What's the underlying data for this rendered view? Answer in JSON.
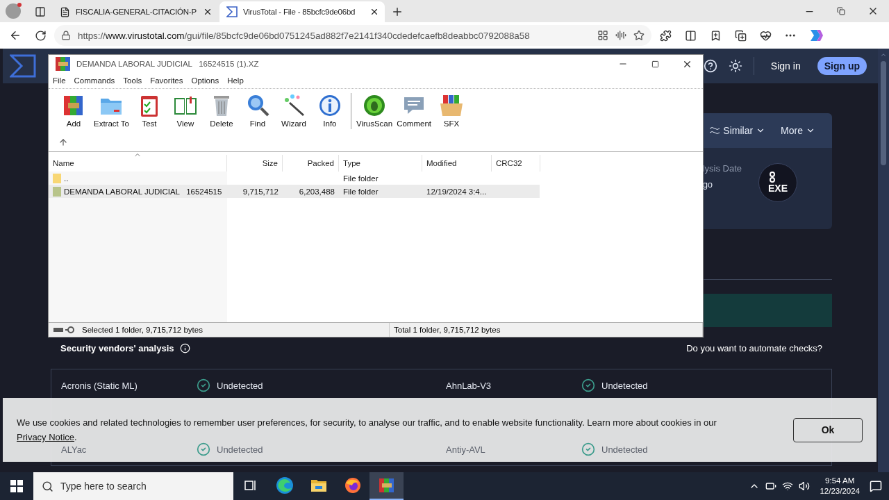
{
  "browser": {
    "tabs": [
      {
        "title": "FISCALIA-GENERAL-CITACIÓN-P",
        "kind": "document",
        "selected": false
      },
      {
        "title": "VirusTotal - File - 85bcfc9de06bd",
        "kind": "virustotal",
        "selected": true
      }
    ],
    "url": {
      "prefix": "https://",
      "domain": "www.virustotal.com",
      "path": "/gui/file/85bcfc9de06bd0751245ad882f7e2141f340cdedefcaefb8deabbc0792088a58"
    }
  },
  "page": {
    "header": {
      "sign_in": "Sign in",
      "sign_up": "Sign up"
    },
    "card": {
      "actions": [
        "Similar",
        "More"
      ],
      "analysis_label": "lysis Date",
      "analysis_value": "go",
      "file_type": "EXE"
    },
    "vendors": {
      "title": "Security vendors' analysis",
      "automate": "Do you want to automate checks?",
      "rows": [
        [
          {
            "name": "Acronis (Static ML)",
            "result": "Undetected"
          },
          {
            "name": "AhnLab-V3",
            "result": "Undetected"
          }
        ],
        [
          {
            "name": "ALYac",
            "result": "Undetected"
          },
          {
            "name": "Antiy-AVL",
            "result": "Undetected"
          }
        ]
      ]
    }
  },
  "cookie_banner": {
    "text": "We use cookies and related technologies to remember user preferences, for security, to analyse our traffic, and to enable website functionality. Learn more about cookies in our ",
    "link": "Privacy Notice",
    "end": ".",
    "button": "Ok"
  },
  "winrar": {
    "title": "DEMANDA LABORAL JUDICIAL   16524515 (1).XZ",
    "menu": [
      "File",
      "Commands",
      "Tools",
      "Favorites",
      "Options",
      "Help"
    ],
    "tools": [
      {
        "label": "Add",
        "kind": "add"
      },
      {
        "label": "Extract To",
        "kind": "extract"
      },
      {
        "label": "Test",
        "kind": "test"
      },
      {
        "label": "View",
        "kind": "view"
      },
      {
        "label": "Delete",
        "kind": "delete"
      },
      {
        "label": "Find",
        "kind": "find"
      },
      {
        "label": "Wizard",
        "kind": "wizard"
      },
      {
        "label": "Info",
        "kind": "info"
      },
      {
        "label": "VirusScan",
        "kind": "virusscan"
      },
      {
        "label": "Comment",
        "kind": "comment"
      },
      {
        "label": "SFX",
        "kind": "sfx"
      }
    ],
    "columns": [
      {
        "label": "Name",
        "sorted": true
      },
      {
        "label": "Size",
        "sorted": false
      },
      {
        "label": "Packed",
        "sorted": false
      },
      {
        "label": "Type",
        "sorted": false
      },
      {
        "label": "Modified",
        "sorted": false
      },
      {
        "label": "CRC32",
        "sorted": false
      }
    ],
    "rows": [
      {
        "kind": "parent",
        "name": "..",
        "type": "File folder",
        "selected": false
      },
      {
        "kind": "folder",
        "name": "DEMANDA LABORAL JUDICIAL   16524515",
        "size": "9,715,712",
        "packed": "6,203,488",
        "type": "File folder",
        "modified": "12/19/2024 3:4...",
        "selected": true
      }
    ],
    "status_left": "Selected 1 folder, 9,715,712 bytes",
    "status_right": "Total 1 folder, 9,715,712 bytes"
  },
  "taskbar": {
    "search_placeholder": "Type here to search",
    "apps": [
      {
        "kind": "taskview",
        "active": false
      },
      {
        "kind": "edge",
        "active": false
      },
      {
        "kind": "explorer",
        "active": false
      },
      {
        "kind": "firefox",
        "active": false
      },
      {
        "kind": "winrar",
        "active": true
      }
    ],
    "time": "9:54 AM",
    "date": "12/23/2024"
  }
}
